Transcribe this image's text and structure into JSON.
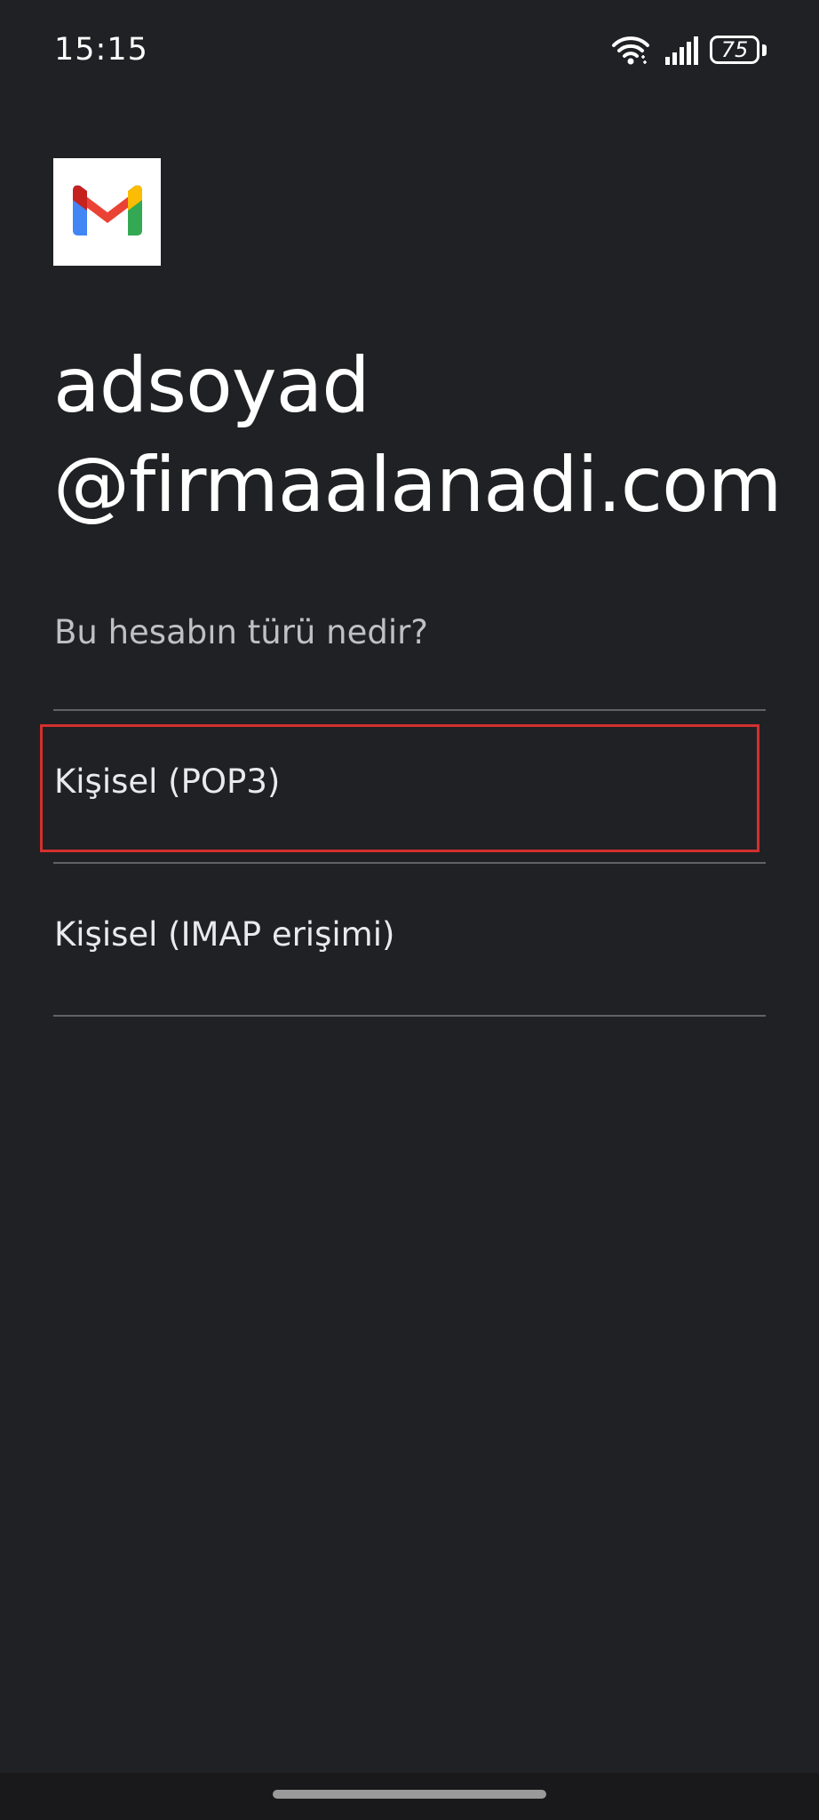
{
  "status_bar": {
    "time": "15:15",
    "battery_level": "75",
    "icons": [
      "wifi-icon",
      "signal-icon",
      "battery-icon"
    ]
  },
  "app": {
    "logo_icon": "gmail-logo-icon"
  },
  "account": {
    "line1": "adsoyad",
    "line2": "@firmaalanadi.com"
  },
  "question": "Bu hesabın türü nedir?",
  "options": [
    {
      "label": "Kişisel (POP3)",
      "highlighted": true
    },
    {
      "label": "Kişisel (IMAP erişimi)",
      "highlighted": false
    }
  ],
  "colors": {
    "background": "#202124",
    "highlight_border": "#d32f2f",
    "divider": "#5f6368"
  }
}
